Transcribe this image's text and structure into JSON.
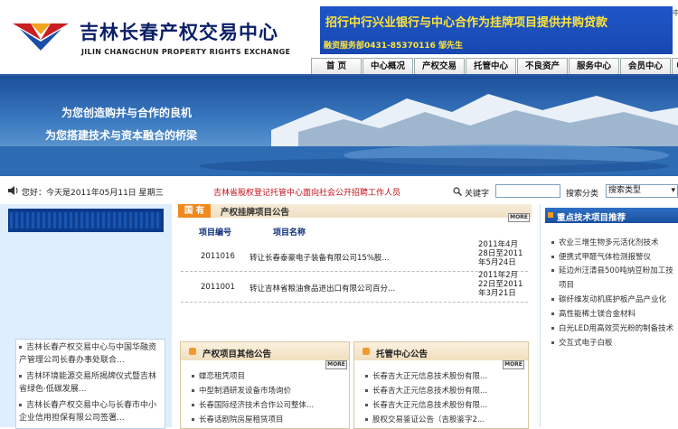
{
  "header": {
    "title": "吉林长春产权交易中心",
    "title_en": "JILIN CHANGCHUN PROPERTY RIGHTS EXCHANGE",
    "banner_text": "招行中行兴业银行与中心合作为挂牌项目提供并购贷款",
    "banner_sub": "融资服务部0431-85370116  邹先生",
    "right_edge": "中"
  },
  "nav": {
    "items": [
      "首 页",
      "中心概况",
      "产权交易",
      "托管中心",
      "不良资产",
      "服务中心",
      "会员中心",
      "中"
    ]
  },
  "hero": {
    "line1": "为您创造购并与合作的良机",
    "line2": "为您搭建技术与资本融合的桥梁"
  },
  "infobar": {
    "date": "您好：今天是2011年05月11日 星期三",
    "notice": "吉林省股权登记托管中心面向社会公开招聘工作人员",
    "keyword_label": "关键字",
    "search_value": "",
    "type_label": "搜索分类",
    "type_selected": "搜索类型"
  },
  "center": {
    "tab_label": "国 有",
    "tab_title": "产权挂牌项目公告",
    "more": "MORE",
    "col_code": "项目编号",
    "col_name": "项目名称",
    "rows": [
      {
        "code": "2011016",
        "name": "转让长春泰豪电子装备有限公司15%股...",
        "date": "2011年4月28日至2011年5月24日"
      },
      {
        "code": "2011001",
        "name": "转让吉林省粮油食品进出口有限公司百分...",
        "date": "2011年2月22日至2011年3月21日"
      }
    ]
  },
  "box_left": {
    "title": "产权项目其他公告",
    "more": "MORE",
    "items": [
      "蝶恋租凭项目",
      "中型制酒研发设备市场询价",
      "长春国际经济技术合作公司整体...",
      "长春话剧院房屋租赁项目"
    ]
  },
  "box_right": {
    "title": "托管中心公告",
    "more": "MORE",
    "items": [
      "长春吉大正元信息技术股份有限...",
      "长春吉大正元信息技术股份有限...",
      "长春吉大正元信息技术股份有限...",
      "股权交易鉴证公告（吉股鉴字2..."
    ]
  },
  "left": {
    "items": [
      "吉林长春产权交易中心与中国华融资产管理公司长春办事处联合...",
      "吉林环境能源交易所揭牌仪式暨吉林省绿色·低碳发展...",
      "吉林长春产权交易中心与长春市中小企业信用担保有限公司签署..."
    ]
  },
  "right": {
    "title": "重点技术项目推荐",
    "items": [
      "农业三增生物多元活化剂技术",
      "便携式甲醛气体检测报警仪",
      "延边州汪清县500吨纳豆粉加工技",
      "项目",
      "碳纤维发动机底护板产品产业化",
      "高性能稀土镁合金材料",
      "白光LED用高效荧光粉的制备技术",
      "交互式电子白板"
    ]
  },
  "colors": {
    "brand_blue": "#0b1f66",
    "nav_line": "#2c59a8",
    "notice_red": "#c0101a",
    "tab_orange": "#f08a1e"
  }
}
